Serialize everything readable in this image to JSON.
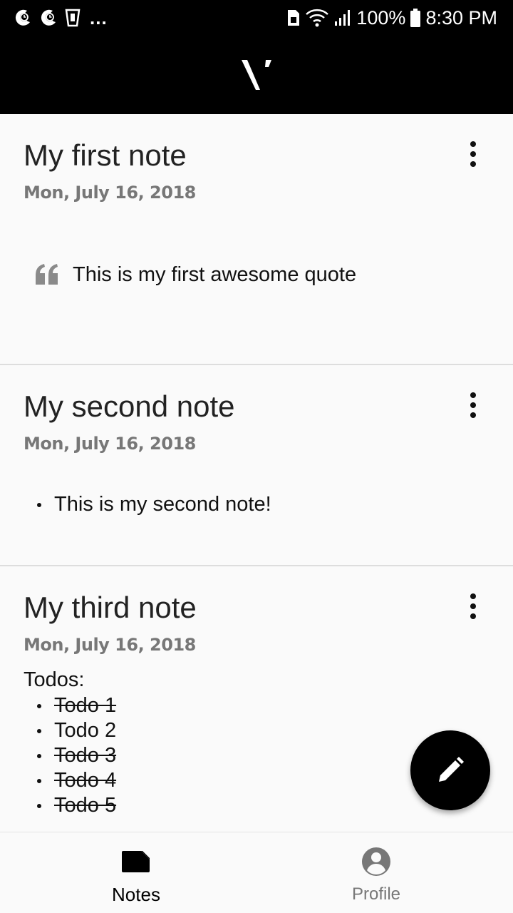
{
  "status_bar": {
    "left_icons": [
      "moon-clock-icon",
      "moon-clock-icon",
      "cup-icon"
    ],
    "more_indicator": "...",
    "right_icons": [
      "sim-card-icon",
      "wifi-icon",
      "signal-icon",
      "battery-icon"
    ],
    "battery": "100%",
    "time": "8:30 PM"
  },
  "app_bar": {
    "logo_icon": "v-logo-icon",
    "background": "#000000"
  },
  "notes": [
    {
      "title": "My first note",
      "date": "Mon, July 16, 2018",
      "quote": "This is my first awesome quote"
    },
    {
      "title": "My second note",
      "date": "Mon, July 16, 2018",
      "bullets": [
        "This is my second note!"
      ]
    },
    {
      "title": "My third note",
      "date": "Mon, July 16, 2018",
      "todos_heading": "Todos:",
      "todos": [
        {
          "text": "Todo 1",
          "done": true
        },
        {
          "text": "Todo 2",
          "done": false
        },
        {
          "text": "Todo 3",
          "done": true
        },
        {
          "text": "Todo 4",
          "done": true
        },
        {
          "text": "Todo 5",
          "done": true
        }
      ]
    }
  ],
  "fab": {
    "icon": "pencil-icon"
  },
  "bottom_nav": {
    "items": [
      {
        "label": "Notes",
        "icon": "note-icon",
        "active": true
      },
      {
        "label": "Profile",
        "icon": "account-circle-icon",
        "active": false
      }
    ]
  },
  "colors": {
    "accent": "#000000",
    "background": "#fafafa",
    "date_text": "#777777",
    "inactive_nav": "#777777"
  }
}
